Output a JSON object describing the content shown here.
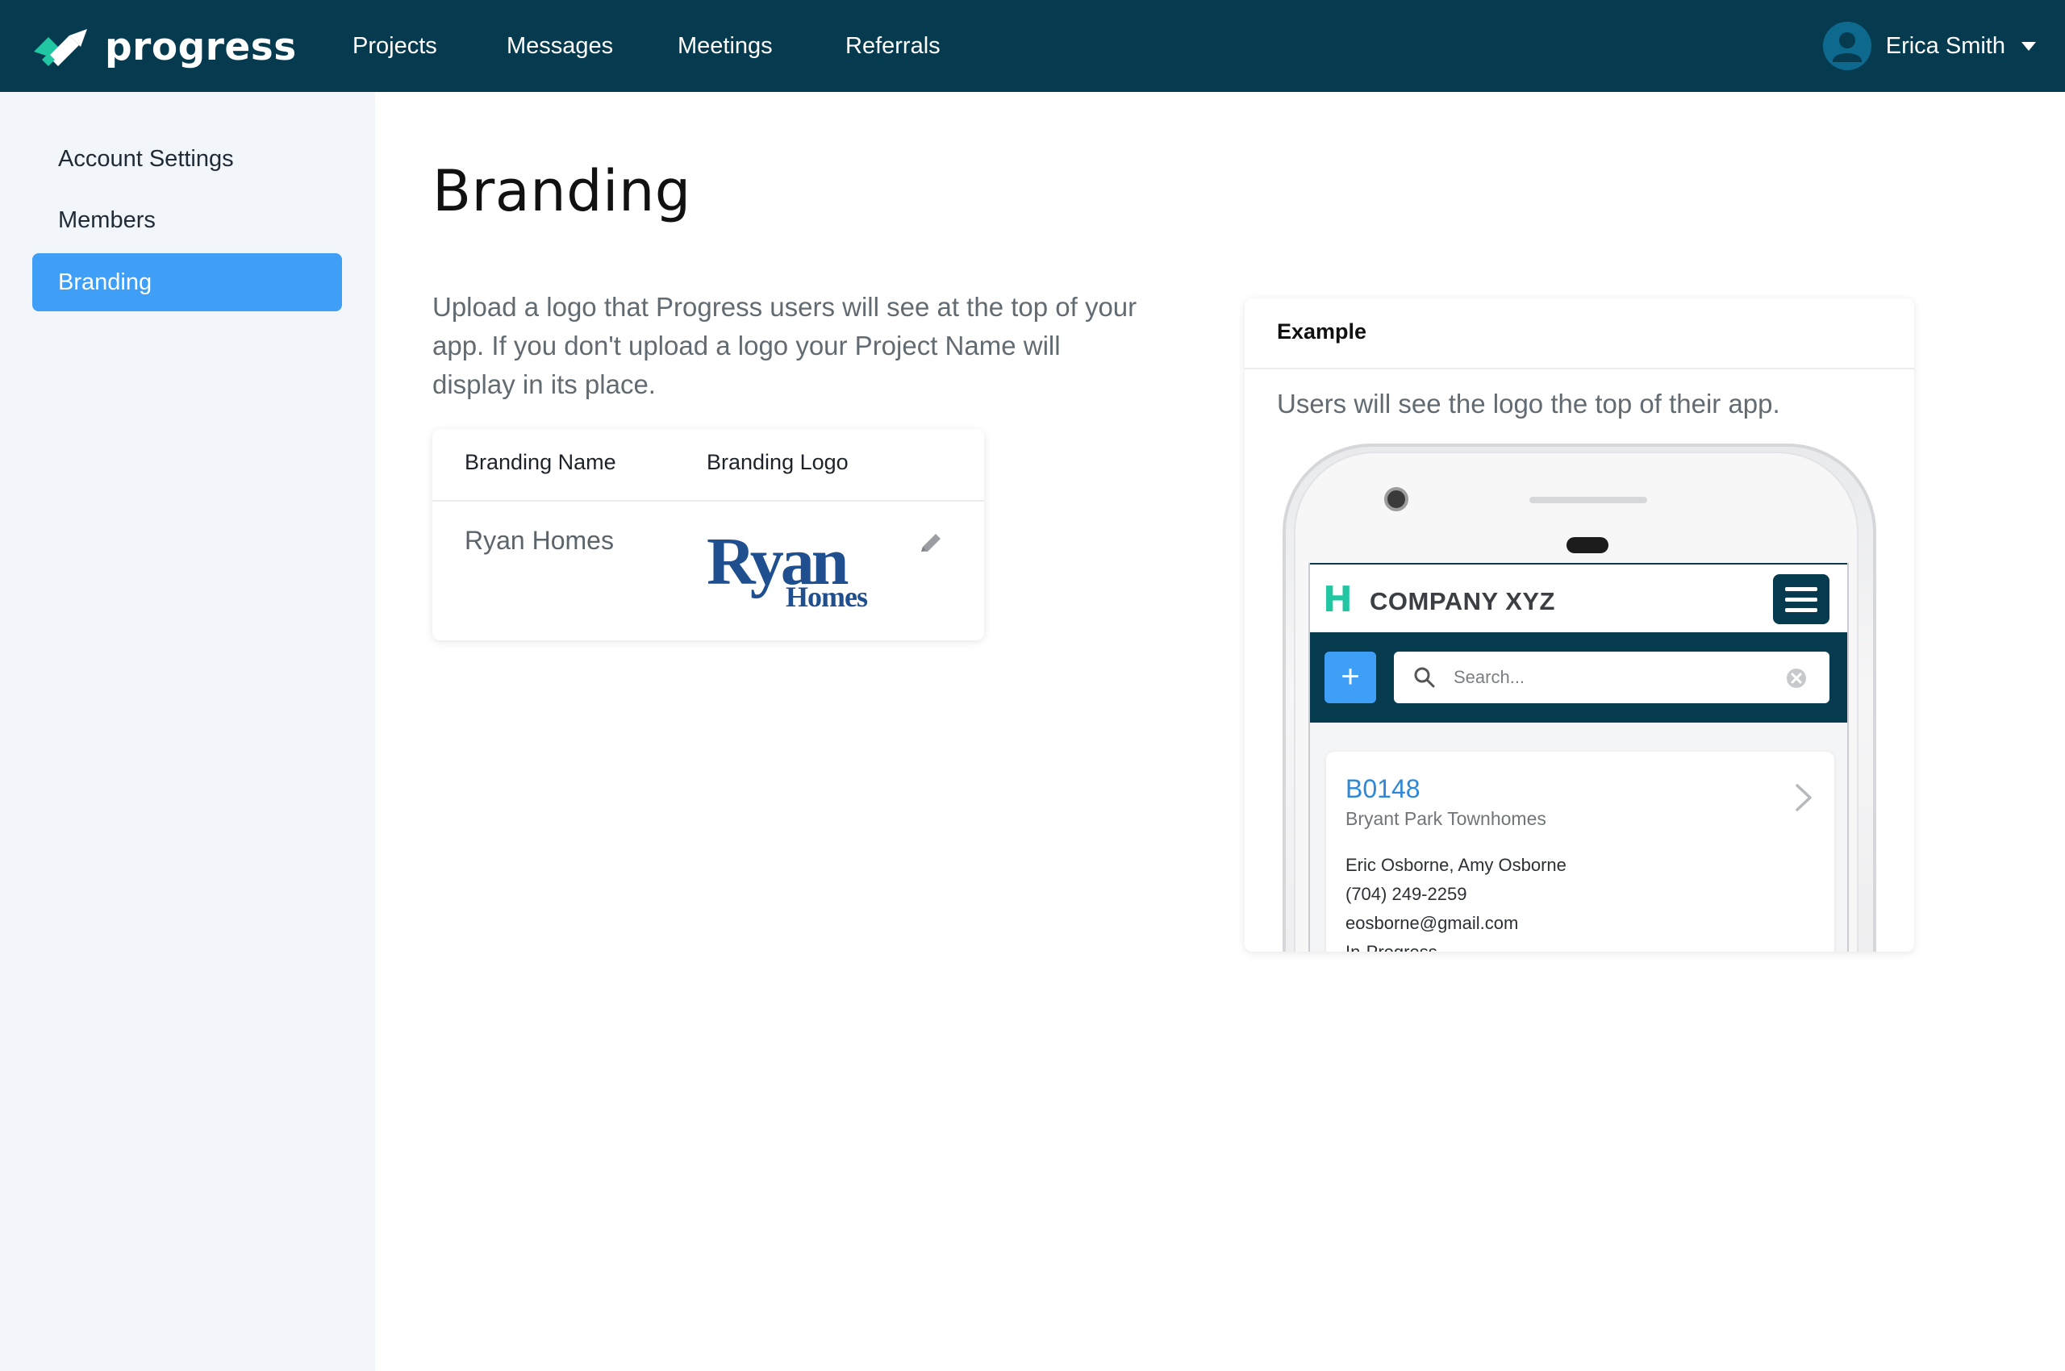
{
  "app": {
    "name": "progress"
  },
  "nav": [
    {
      "label": "Projects"
    },
    {
      "label": "Messages"
    },
    {
      "label": "Meetings"
    },
    {
      "label": "Referrals"
    }
  ],
  "user": {
    "name": "Erica Smith"
  },
  "sidebar": {
    "items": [
      {
        "label": "Account Settings",
        "active": false
      },
      {
        "label": "Members",
        "active": false
      },
      {
        "label": "Branding",
        "active": true
      }
    ]
  },
  "main": {
    "title": "Branding",
    "description": "Upload a logo that Progress users will see at the top of your app. If you don't upload a logo your Project Name will display in its place.",
    "table": {
      "columns": [
        "Branding Name",
        "Branding Logo"
      ],
      "row": {
        "name": "Ryan Homes",
        "logo_text": "Ryan",
        "logo_subtext": "Homes"
      }
    }
  },
  "example": {
    "title": "Example",
    "subtitle": "Users will see the logo the top of their app.",
    "phone": {
      "logo_letter": "H",
      "company": "COMPANY XYZ",
      "add_label": "+",
      "search_placeholder": "Search...",
      "job": {
        "id": "B0148",
        "name": "Bryant Park Townhomes",
        "contacts": "Eric Osborne, Amy Osborne",
        "phone": "(704) 249-2259",
        "email": "eosborne@gmail.com",
        "status": "In-Progress"
      }
    }
  },
  "colors": {
    "nav_bg": "#053a4f",
    "accent": "#3f9ef5",
    "sidebar_bg": "#f2f5fa",
    "brand_green": "#21c7a2",
    "ryan_blue": "#1f4f8f"
  }
}
